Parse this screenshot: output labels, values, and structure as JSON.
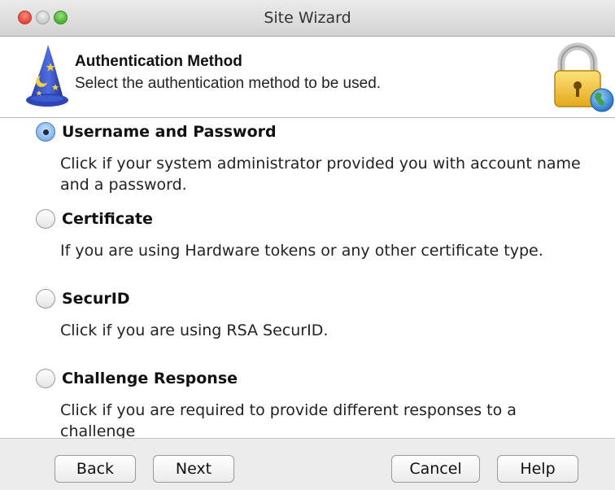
{
  "window": {
    "title": "Site Wizard"
  },
  "header": {
    "title": "Authentication Method",
    "subtitle": "Select the authentication method to be used.",
    "left_icon": "wizard-hat-icon",
    "right_icon": "lock-globe-icon"
  },
  "options": [
    {
      "label": "Username and Password",
      "description": "Click if your system administrator provided you with account name and a password.",
      "selected": true
    },
    {
      "label": "Certificate",
      "description": "If you are using Hardware tokens or any other certificate type.",
      "selected": false
    },
    {
      "label": "SecurID",
      "description": "Click if you are using RSA SecurID.",
      "selected": false
    },
    {
      "label": "Challenge Response",
      "description": "Click if you are required to provide different responses to a challenge",
      "selected": false
    }
  ],
  "buttons": {
    "back": "Back",
    "next": "Next",
    "cancel": "Cancel",
    "help": "Help"
  },
  "colors": {
    "accent": "#4a7fc6",
    "close": "#e0443a",
    "minimize": "#c9c9c9",
    "maximize": "#4cae32"
  }
}
